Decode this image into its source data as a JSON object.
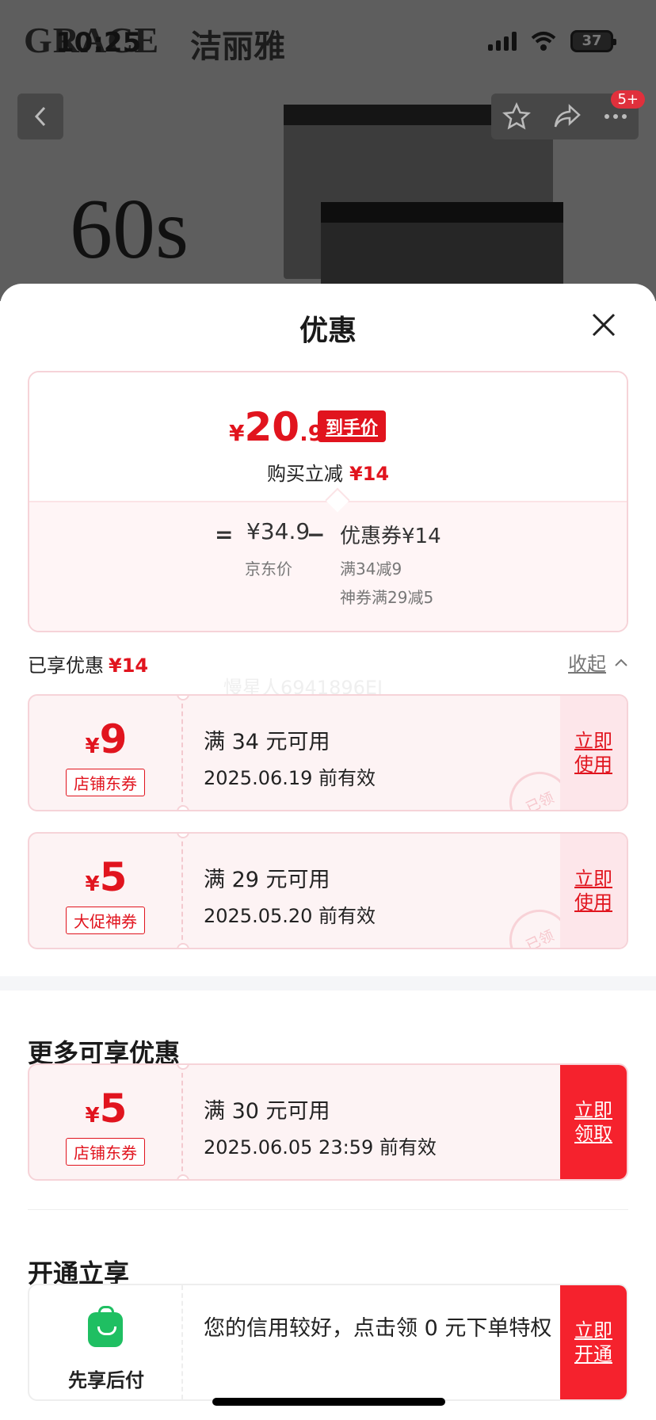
{
  "status_bar": {
    "time": "10:25",
    "battery": "37"
  },
  "product_bg": {
    "brand_en": "GRACE",
    "brand_cn": "洁丽雅",
    "spec": "60s",
    "badge": "5+"
  },
  "sheet": {
    "title": "优惠",
    "price": {
      "symbol": "¥",
      "integer": "20",
      "decimal": ".9",
      "tag": "到手价",
      "reduce_label": "购买立减",
      "reduce_value": "¥14",
      "equals": "=",
      "original": "¥34.9",
      "original_label": "京东价",
      "minus": "−",
      "coupon_line": "优惠券¥14",
      "coupon_detail_1": "满34减9",
      "coupon_detail_2": "神券满29减5"
    },
    "enjoyed": {
      "label": "已享优惠",
      "value": "¥14",
      "collapse": "收起"
    },
    "watermark": "慢星人6941896EI",
    "coupons": [
      {
        "symbol": "¥",
        "amount": "9",
        "type": "店铺东券",
        "condition": "满 34 元可用",
        "expiry": "2025.06.19 前有效",
        "action": "立即使用",
        "stamp": "已领"
      },
      {
        "symbol": "¥",
        "amount": "5",
        "type": "大促神券",
        "condition": "满 29 元可用",
        "expiry": "2025.05.20 前有效",
        "action": "立即使用",
        "stamp": "已领"
      }
    ],
    "more_section": {
      "title": "更多可享优惠",
      "coupon": {
        "symbol": "¥",
        "amount": "5",
        "type": "店铺东券",
        "condition": "满 30 元可用",
        "expiry": "2025.06.05 23:59 前有效",
        "action": "立即领取"
      }
    },
    "open_section": {
      "title": "开通立享",
      "card": {
        "label": "先享后付",
        "text": "您的信用较好，点击领 0 元下单特权",
        "action": "立即开通"
      }
    }
  },
  "colors": {
    "accent": "#e1141e",
    "solid_button": "#f5222d",
    "coupon_bg": "#fdf3f4",
    "pay_icon": "#1fbf62"
  }
}
